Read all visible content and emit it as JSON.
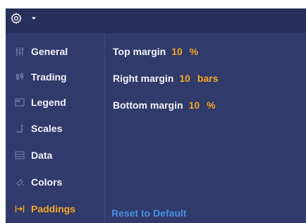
{
  "toolbar": {
    "gear_icon": "gear-icon",
    "caret_icon": "caret-down-icon"
  },
  "sidebar": {
    "items": [
      {
        "label": "General",
        "icon": "sliders-icon",
        "active": false
      },
      {
        "label": "Trading",
        "icon": "trading-icon",
        "active": false
      },
      {
        "label": "Legend",
        "icon": "legend-icon",
        "active": false
      },
      {
        "label": "Scales",
        "icon": "scales-icon",
        "active": false
      },
      {
        "label": "Data",
        "icon": "data-icon",
        "active": false
      },
      {
        "label": "Colors",
        "icon": "colors-icon",
        "active": false
      },
      {
        "label": "Paddings",
        "icon": "paddings-icon",
        "active": true
      }
    ]
  },
  "paddings": {
    "top": {
      "label": "Top margin",
      "value": "10",
      "unit": "%"
    },
    "right": {
      "label": "Right margin",
      "value": "10",
      "unit": "bars"
    },
    "bottom": {
      "label": "Bottom margin",
      "value": "10",
      "unit": "%"
    }
  },
  "footer": {
    "reset_label": "Reset to Default"
  },
  "colors": {
    "accent": "#f5a623",
    "link": "#4a90e2",
    "panel_bg": "#303a6b",
    "topbar_bg": "#26305a"
  }
}
